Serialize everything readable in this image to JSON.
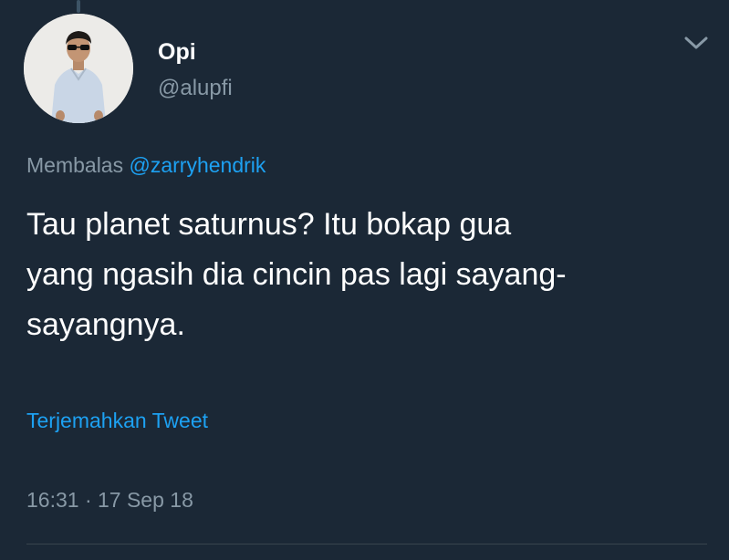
{
  "author": {
    "display_name": "Opi",
    "handle": "@alupfi"
  },
  "tweet": {
    "reply_prefix": "Membalas ",
    "reply_to": "@zarryhendrik",
    "text_lines": [
      "Tau planet saturnus? Itu bokap gua",
      "yang ngasih dia cincin pas lagi sayang-",
      "sayangnya."
    ],
    "translate_label": "Terjemahkan Tweet",
    "timestamp": "16:31 · 17 Sep 18"
  },
  "icons": {
    "menu": "chevron-down-icon"
  },
  "colors": {
    "background": "#1b2836",
    "primary_text": "#ffffff",
    "secondary_text": "#8899a6",
    "link": "#1da1f2",
    "divider": "#38444d"
  }
}
